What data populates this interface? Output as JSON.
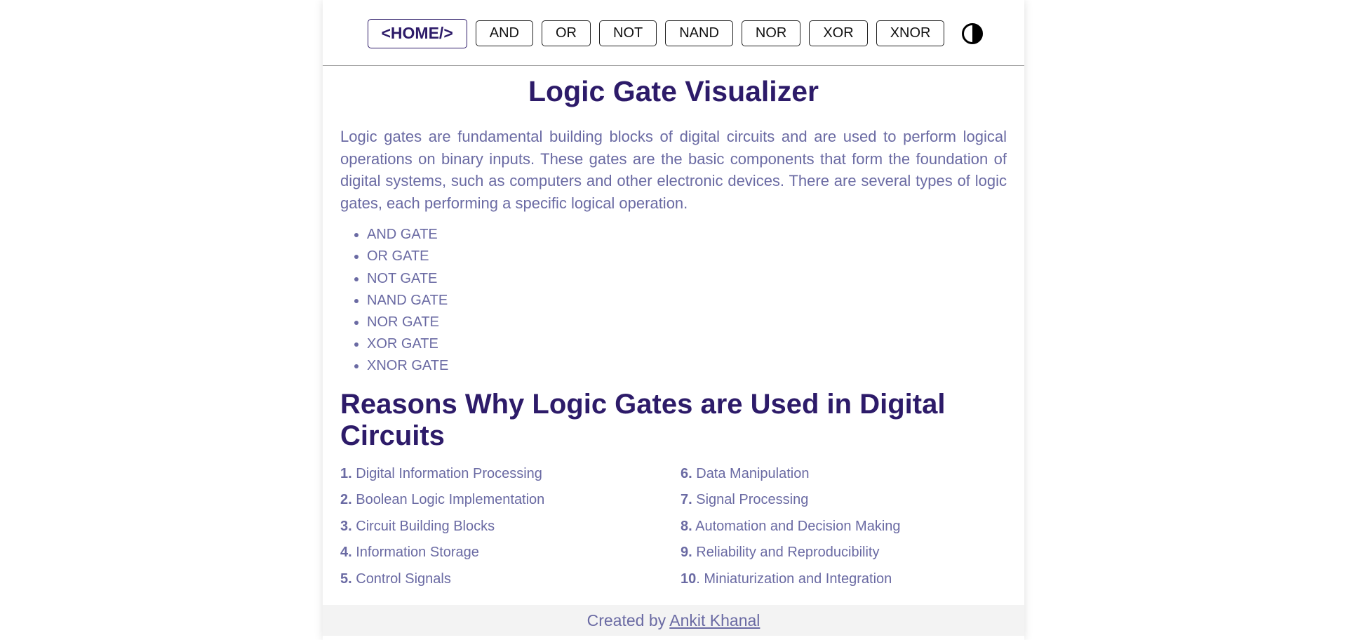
{
  "nav": {
    "home": "<HOME/>",
    "items": [
      "AND",
      "OR",
      "NOT",
      "NAND",
      "NOR",
      "XOR",
      "XNOR"
    ],
    "theme_icon": "half-circle-contrast-icon"
  },
  "title": "Logic Gate Visualizer",
  "intro": "Logic gates are fundamental building blocks of digital circuits and are used to perform logical operations on binary inputs. These gates are the basic components that form the foundation of digital systems, such as computers and other electronic devices. There are several types of logic gates, each performing a specific logical operation.",
  "gates": [
    "AND GATE",
    "OR GATE",
    "NOT GATE",
    "NAND GATE",
    "NOR GATE",
    "XOR GATE",
    "XNOR GATE"
  ],
  "reasons_title": "Reasons Why Logic Gates are Used in Digital Circuits",
  "reasons_left": [
    {
      "num": "1.",
      "text": " Digital Information Processing"
    },
    {
      "num": "2.",
      "text": " Boolean Logic Implementation"
    },
    {
      "num": "3.",
      "text": " Circuit Building Blocks"
    },
    {
      "num": "4.",
      "text": " Information Storage"
    },
    {
      "num": "5.",
      "text": " Control Signals"
    }
  ],
  "reasons_right": [
    {
      "num": "6.",
      "text": " Data Manipulation"
    },
    {
      "num": "7.",
      "text": " Signal Processing"
    },
    {
      "num": "8.",
      "text": " Automation and Decision Making"
    },
    {
      "num": "9.",
      "text": " Reliability and Reproducibility"
    },
    {
      "num": "10",
      "text": ". Miniaturization and Integration"
    }
  ],
  "footer": {
    "prefix": "Created by ",
    "author": "Ankit Khanal"
  },
  "colors": {
    "heading": "#2d1b69",
    "body_text": "#6a6aa3",
    "footer_bg": "#f3f3f3"
  }
}
